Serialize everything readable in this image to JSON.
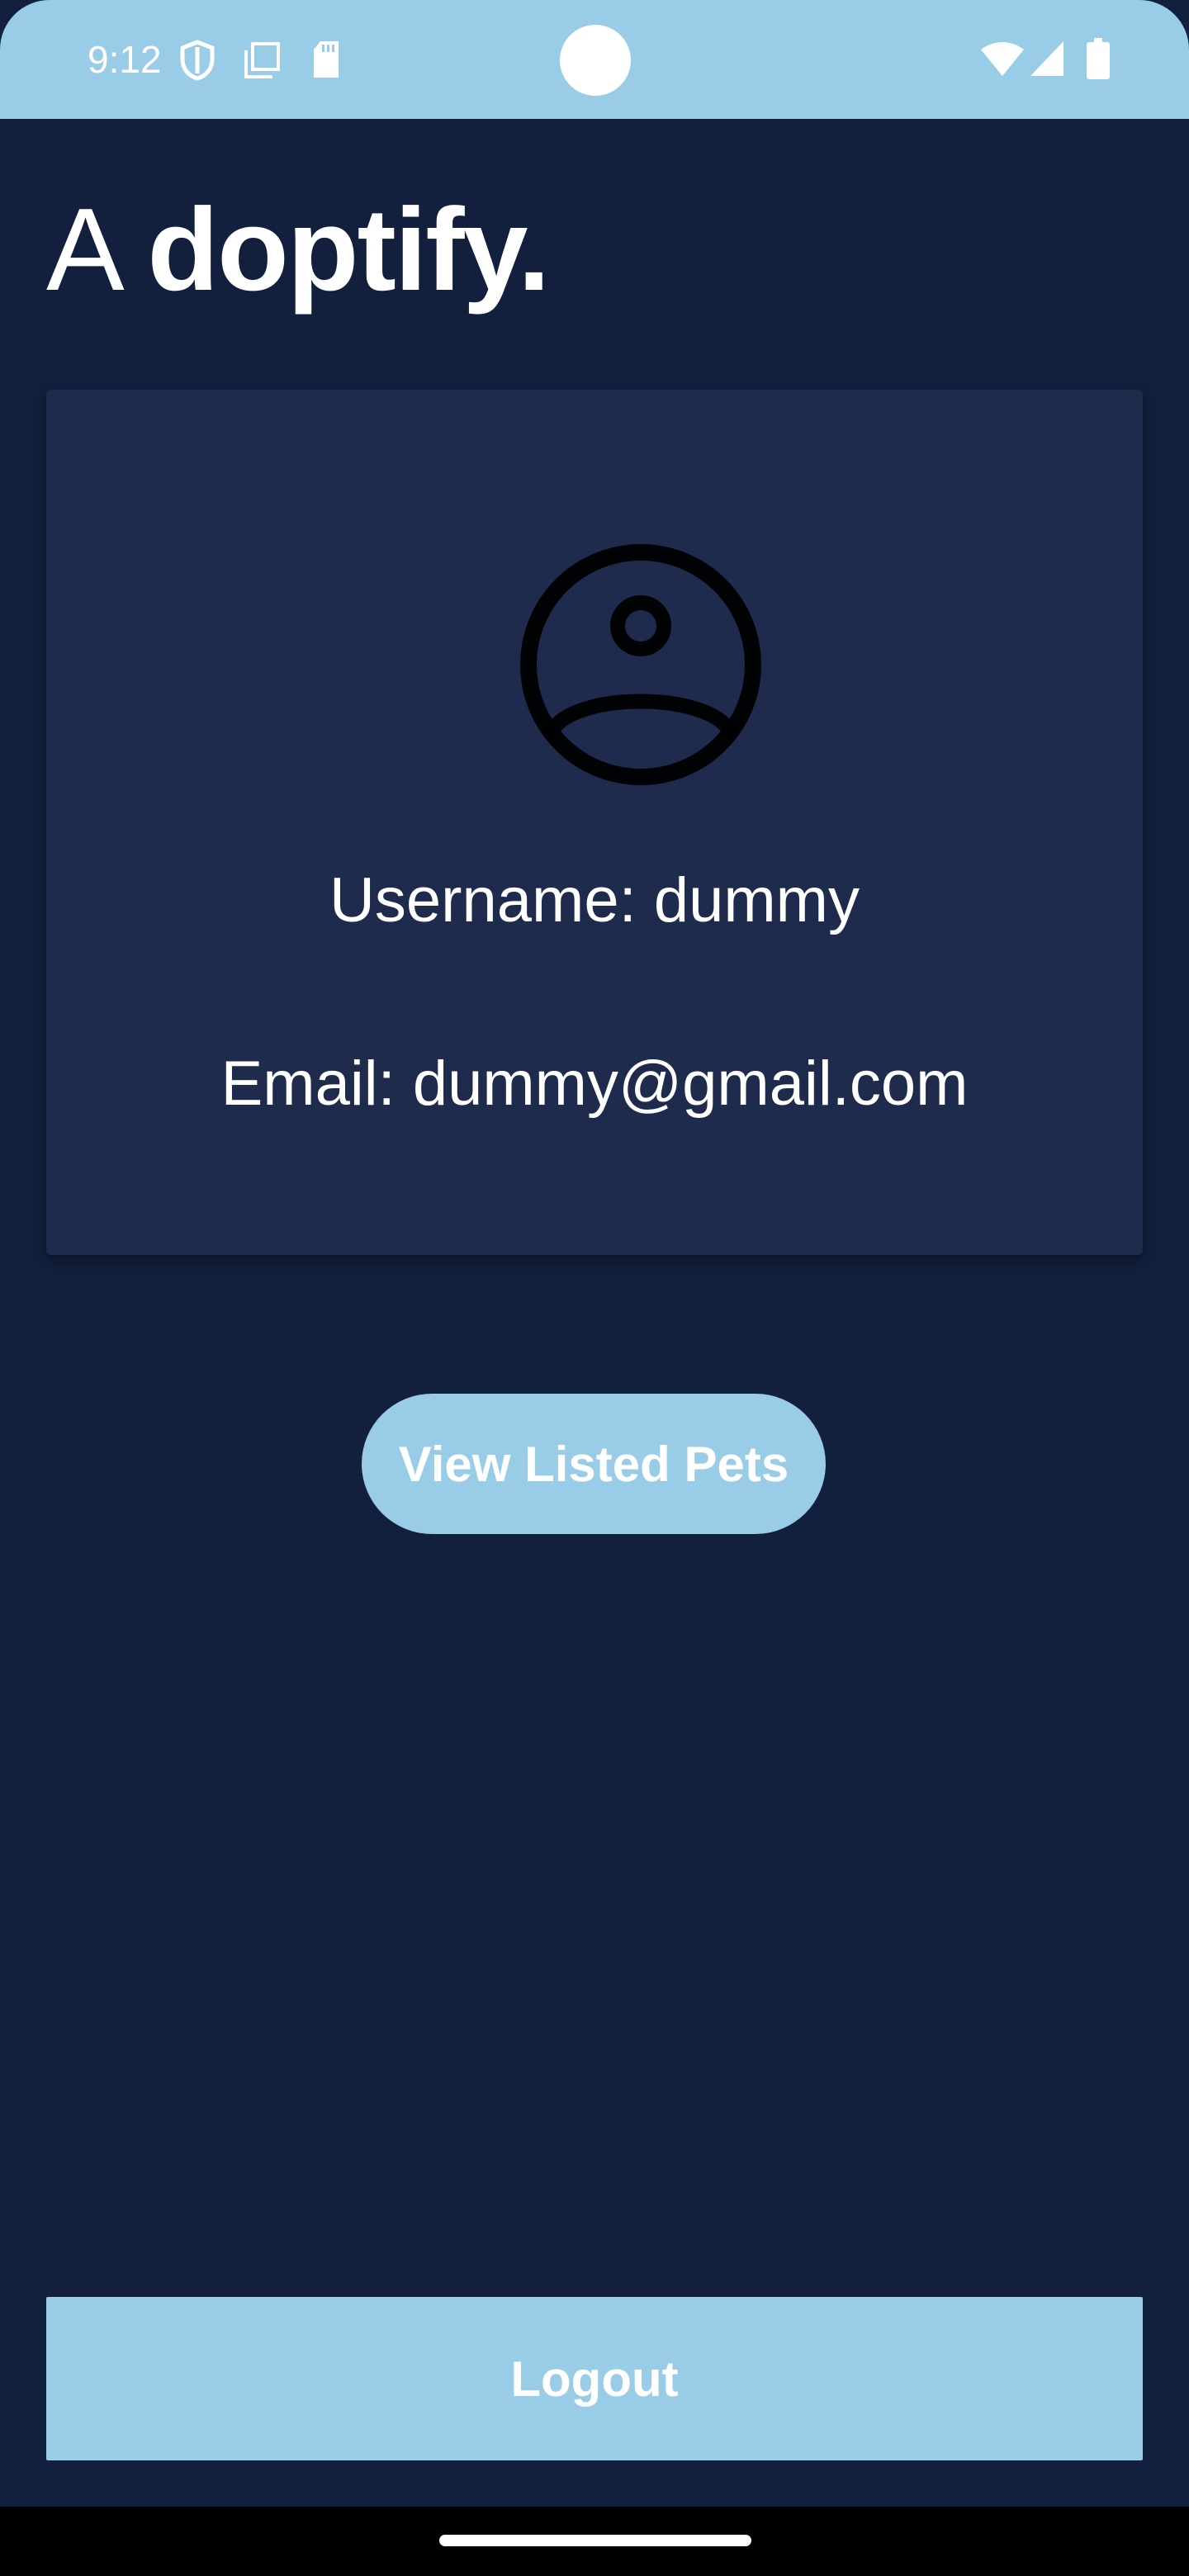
{
  "status_bar": {
    "time": "9:12",
    "left_icons": [
      "shield-icon",
      "screen-copy-icon",
      "sd-card-icon"
    ],
    "right_icons": [
      "wifi-icon",
      "signal-icon",
      "battery-icon"
    ],
    "background": "#99cce6"
  },
  "app": {
    "title_light": "A ",
    "title_bold": "doptify."
  },
  "profile": {
    "avatar_icon": "account-circle-icon",
    "username_text": "Username: dummy",
    "email_text": "Email: dummy@gmail.com"
  },
  "actions": {
    "view_pets_label": "View Listed Pets",
    "logout_label": "Logout"
  },
  "colors": {
    "background": "#121f3d",
    "card": "#1f2b4d",
    "accent": "#99cce6",
    "text": "#ffffff"
  }
}
